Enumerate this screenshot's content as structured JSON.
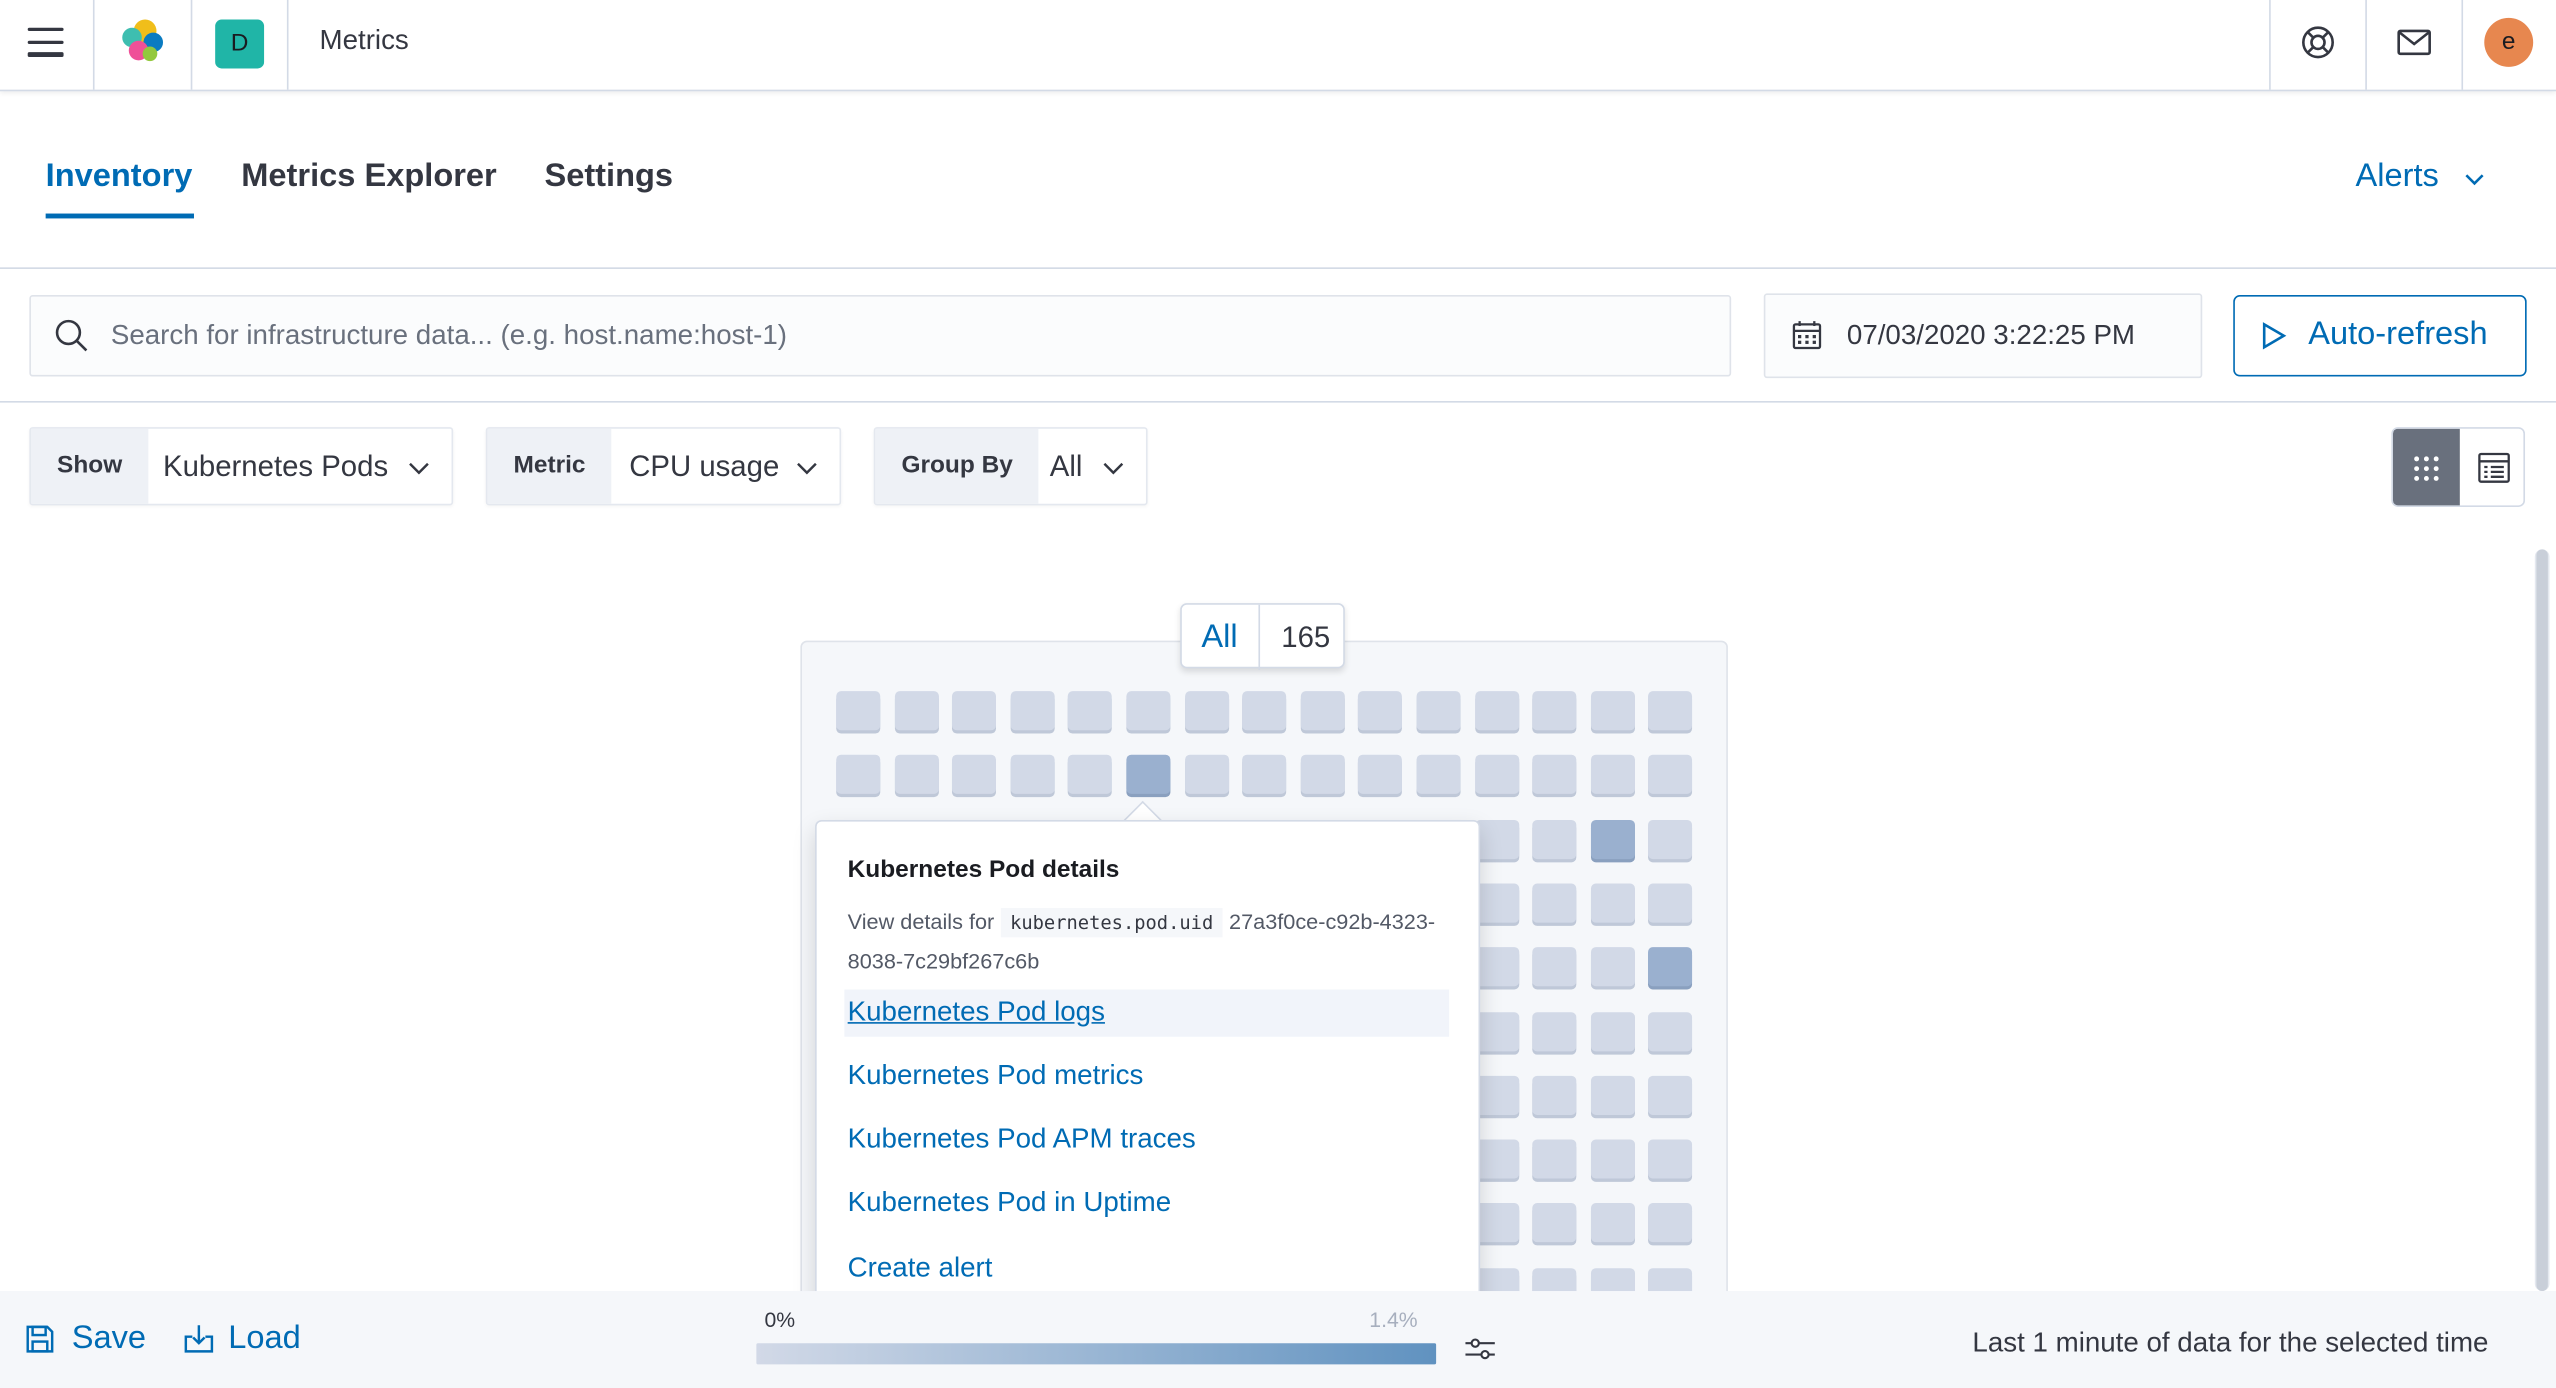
{
  "header": {
    "space_initial": "D",
    "app_title": "Metrics",
    "user_initial": "e",
    "icons": [
      "menu-icon",
      "elastic-logo",
      "help-icon",
      "newsfeed-icon"
    ]
  },
  "tabs": [
    {
      "label": "Inventory",
      "active": true
    },
    {
      "label": "Metrics Explorer",
      "active": false
    },
    {
      "label": "Settings",
      "active": false
    }
  ],
  "alerts_menu": {
    "label": "Alerts"
  },
  "search": {
    "placeholder": "Search for infrastructure data... (e.g. host.name:host-1)"
  },
  "date_picker": {
    "value": "07/03/2020 3:22:25 PM"
  },
  "auto_refresh": {
    "label": "Auto-refresh"
  },
  "selectors": {
    "show": {
      "label": "Show",
      "value": "Kubernetes Pods"
    },
    "metric": {
      "label": "Metric",
      "value": "CPU usage"
    },
    "group_by": {
      "label": "Group By",
      "value": "All"
    }
  },
  "view_toggle": {
    "active": "map"
  },
  "map": {
    "group_label": "All",
    "group_count": "165"
  },
  "popover": {
    "title": "Kubernetes Pod details",
    "desc_prefix": "View details for",
    "field": "kubernetes.pod.uid",
    "uid": "27a3f0ce-c92b-4323-8038-7c29bf267c6b",
    "links": [
      "Kubernetes Pod logs",
      "Kubernetes Pod metrics",
      "Kubernetes Pod APM traces",
      "Kubernetes Pod in Uptime",
      "Create alert"
    ]
  },
  "bottom": {
    "save_label": "Save",
    "load_label": "Load",
    "legend_min": "0%",
    "legend_max": "1.4%",
    "note": "Last 1 minute of data for the selected time"
  },
  "colors": {
    "accent": "#006bb4",
    "cell": "#d2d9e7",
    "cell_highlight": "#9ab0cf",
    "space_avatar": "#20b5a7",
    "user_avatar": "#e7874f"
  }
}
